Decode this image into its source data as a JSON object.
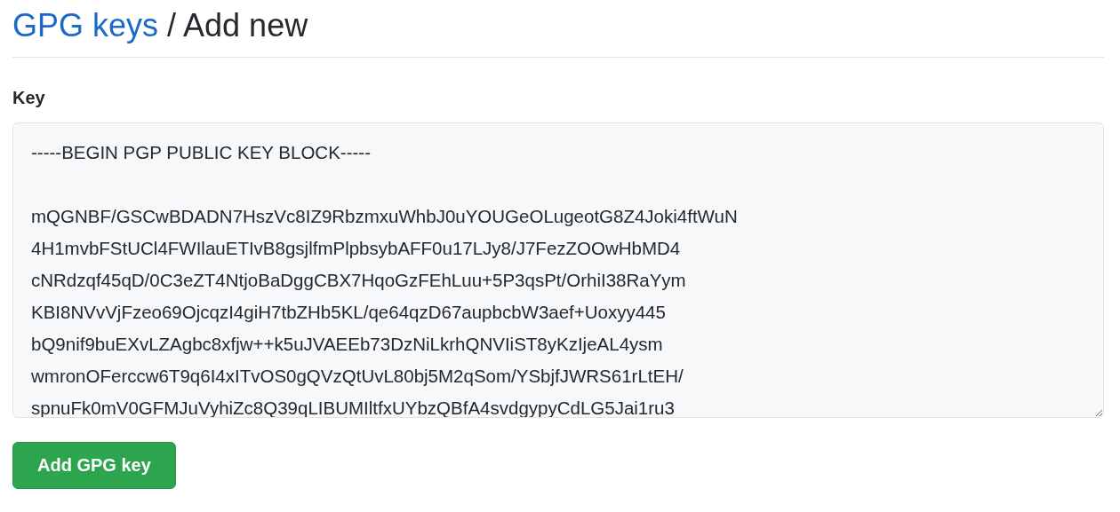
{
  "header": {
    "breadcrumb_link": "GPG keys",
    "title": "/ Add new"
  },
  "key_field": {
    "label": "Key",
    "armor_header": "-----BEGIN PGP PUBLIC KEY BLOCK-----",
    "value_lines": [
      "mQGNBF/GSCwBDADN7HszVc8IZ9RbzmxuWhbJ0uYOUGeOLugeotG8Z4Joki4ftWuN",
      "4H1mvbFStUCl4FWIlauETIvB8gsjlfmPlpbsybAFF0u17LJy8/J7FezZOOwHbMD4",
      "cNRdzqf45qD/0C3eZT4NtjoBaDggCBX7HqoGzFEhLuu+5P3qsPt/OrhiI38RaYym",
      "KBI8NVvVjFzeo69OjcqzI4giH7tbZHb5KL/qe64qzD67aupbcbW3aef+Uoxyy445",
      "bQ9nif9buEXvLZAgbc8xfjw++k5uJVAEEb73DzNiLkrhQNVIiST8yKzIjeAL4ysm",
      "wmronOFerccw6T9q6I4xITvOS0gQVzQtUvL80bj5M2qSom/YSbjfJWRS61rLtEH/",
      "spnuFk0mV0GFMJuVyhiZc8Q39qLIBUMIltfxUYbzQBfA4svdgypyCdLG5Jai1ru3"
    ]
  },
  "submit_button": {
    "label": "Add GPG key"
  }
}
